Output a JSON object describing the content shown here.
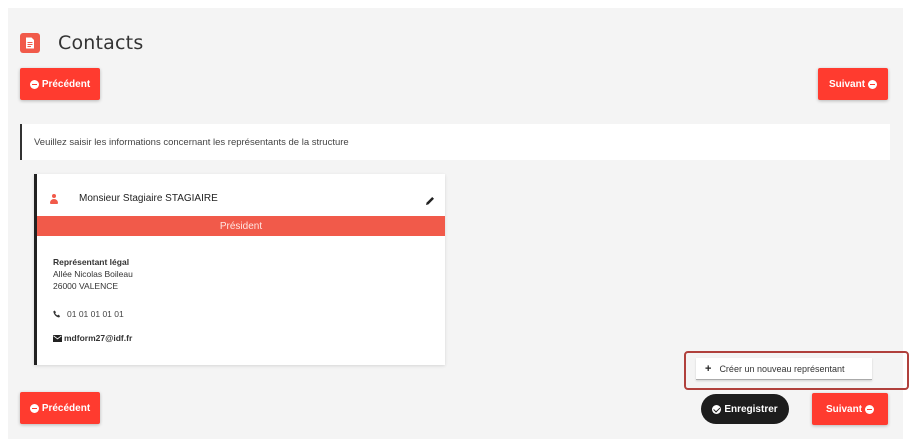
{
  "header": {
    "title": "Contacts"
  },
  "nav": {
    "prev_label": "Précédent",
    "next_label": "Suivant"
  },
  "info": {
    "text": "Veuillez saisir les informations concernant les représentants de la structure"
  },
  "card": {
    "name": "Monsieur Stagiaire STAGIAIRE",
    "role": "Président",
    "rep_title": "Représentant légal",
    "address_line1": "Allée Nicolas Boileau",
    "address_line2": "26000 VALENCE",
    "phone": "01 01 01 01 01",
    "email": "mdform27@idf.fr"
  },
  "actions": {
    "create_label": "Créer un nouveau représentant",
    "save_label": "Enregistrer"
  },
  "colors": {
    "accent": "#ff3b2f",
    "role_bar": "#f15a4a",
    "dark": "#1d1d1d"
  },
  "icons": [
    "document-icon",
    "user-icon",
    "pencil-icon",
    "phone-icon",
    "envelope-icon",
    "plus-icon",
    "check-circle-icon",
    "arrow-circle-icon"
  ]
}
